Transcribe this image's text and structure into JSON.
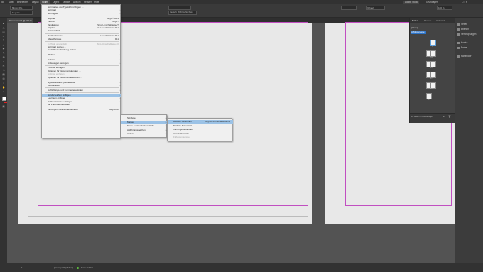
{
  "menubar": {
    "items": [
      "Datei",
      "Bearbeiten",
      "Layout",
      "Schrift",
      "Objekt",
      "Tabelle",
      "Ansicht",
      "Fenster",
      "Hilfe"
    ],
    "right_label": "Grundlagen",
    "search_placeholder": "Adobe Stock"
  },
  "control": {
    "font_name": "Minion Pro",
    "font_style": "Regular",
    "lang": "Deutsch: 2006 Rechtschreib",
    "zoom": "100 %",
    "paragraph_style": "[Ohne]"
  },
  "document": {
    "tab_label": "*Unbenannt-1 @ 100 %"
  },
  "schrift_menu": [
    {
      "label": "Schriftarten von Typekit hinzufügen …",
      "shortcut": "",
      "arrow": false
    },
    {
      "label": "Schriftart",
      "shortcut": "",
      "arrow": true
    },
    {
      "label": "Schriftgrad",
      "shortcut": "",
      "arrow": true
    },
    {
      "sep": true
    },
    {
      "label": "Glyphen",
      "shortcut": "Strg+⇧+F11",
      "arrow": false
    },
    {
      "label": "Zeichen",
      "shortcut": "Strg+T",
      "arrow": false
    },
    {
      "label": "Tabulatoren",
      "shortcut": "Strg+Umschalttaste+T",
      "arrow": false
    },
    {
      "label": "Glyphen",
      "shortcut": "Alt+Umschalttaste+F11",
      "arrow": false
    },
    {
      "label": "Textabschnitt",
      "shortcut": "",
      "arrow": false
    },
    {
      "sep": true
    },
    {
      "label": "Zeichenformate",
      "shortcut": "Umschalttaste+F11",
      "arrow": false
    },
    {
      "label": "Absatzformate",
      "shortcut": "F11",
      "arrow": false
    },
    {
      "sep": true
    },
    {
      "label": "In Pfade umwandeln",
      "shortcut": "Strg+Umschalttaste+O",
      "arrow": false,
      "disabled": true
    },
    {
      "label": "Schriftart suchen …",
      "shortcut": "",
      "arrow": false
    },
    {
      "label": "Groß-/Kleinschreibung ändern",
      "shortcut": "",
      "arrow": true
    },
    {
      "sep": true
    },
    {
      "label": "Pfadtext",
      "shortcut": "",
      "arrow": true
    },
    {
      "sep": true
    },
    {
      "label": "Notizen",
      "shortcut": "",
      "arrow": true
    },
    {
      "label": "Änderungen verfolgen",
      "shortcut": "",
      "arrow": true
    },
    {
      "sep": true
    },
    {
      "label": "Fußnote einfügen",
      "shortcut": "",
      "arrow": false
    },
    {
      "label": "Optionen für Dokumentfußnoten …",
      "shortcut": "",
      "arrow": false
    },
    {
      "label": "Endnote einfügen",
      "shortcut": "",
      "arrow": false,
      "disabled": true
    },
    {
      "label": "Optionen für Dokument-Endnoten …",
      "shortcut": "",
      "arrow": false
    },
    {
      "sep": true
    },
    {
      "label": "Hyperlinks und Querverweise",
      "shortcut": "",
      "arrow": true
    },
    {
      "label": "Textvariablen",
      "shortcut": "",
      "arrow": true
    },
    {
      "sep": true
    },
    {
      "label": "Aufzählungs- und nummerierte Listen",
      "shortcut": "",
      "arrow": true
    },
    {
      "sep": true
    },
    {
      "label": "Sonderzeichen einfügen",
      "shortcut": "",
      "arrow": true,
      "highlight": true
    },
    {
      "label": "Leerraum einfügen",
      "shortcut": "",
      "arrow": true
    },
    {
      "label": "Umbruchzeichen einfügen",
      "shortcut": "",
      "arrow": true
    },
    {
      "label": "Mit Platzhaltertext füllen",
      "shortcut": "",
      "arrow": false
    },
    {
      "sep": true
    },
    {
      "label": "Verborgene Zeichen einblenden",
      "shortcut": "Strg+Alt+I",
      "arrow": false
    }
  ],
  "sonderzeichen_menu": [
    {
      "label": "Symbole",
      "arrow": true
    },
    {
      "label": "Marken",
      "arrow": true,
      "highlight": true
    },
    {
      "label": "Trenn- und Gedankenstriche",
      "arrow": true
    },
    {
      "label": "Anführungszeichen",
      "arrow": true
    },
    {
      "label": "Andere",
      "arrow": true
    }
  ],
  "marken_menu": [
    {
      "label": "Aktuelle Seitenzahl",
      "shortcut": "Strg+Alt+Umschalttaste+N",
      "highlight": true
    },
    {
      "label": "Nächste Seitenzahl",
      "shortcut": ""
    },
    {
      "label": "Vorherige Seitenzahl",
      "shortcut": ""
    },
    {
      "label": "Abschnittsmarke",
      "shortcut": ""
    },
    {
      "label": "Fußnotennummer",
      "shortcut": "",
      "disabled": true
    }
  ],
  "pages_panel": {
    "tabs": [
      "Seiten",
      "Ebenen",
      "Verknüpf."
    ],
    "none_label": "[Ohne]",
    "master_label": "A-Musterseite",
    "page_labels": [
      "1",
      "2-3",
      "4-5",
      "6-7",
      "8-9",
      "10"
    ],
    "footer": "10 Seiten in 6 Druckbögen"
  },
  "right_dock": {
    "items": [
      "Seiten",
      "Ebenen",
      "Verknüpfungen",
      "Kontur",
      "Farbe",
      "Farbfelder"
    ]
  },
  "status": {
    "page_num": "1",
    "preflight": "[Grundprofil] (Arbeit)",
    "errors": "Keine Fehler"
  }
}
